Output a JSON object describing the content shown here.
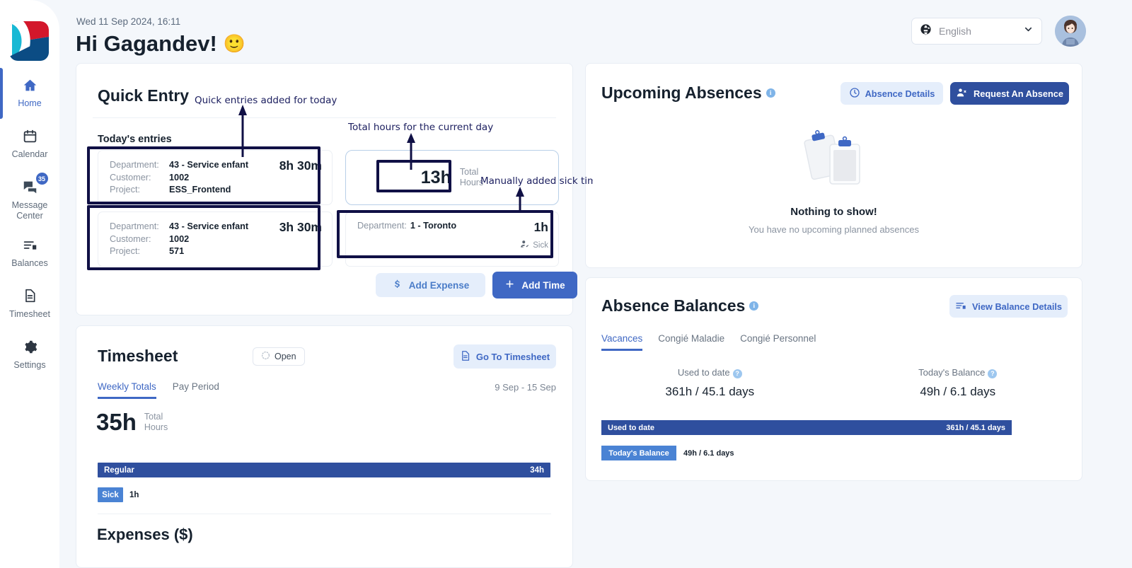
{
  "sidebar": {
    "logo_name": "company-logo",
    "items": [
      {
        "label": "Home",
        "icon": "home-icon",
        "active": true
      },
      {
        "label": "Calendar",
        "icon": "calendar-icon",
        "active": false
      },
      {
        "label": "Message\nCenter",
        "icon": "message-icon",
        "active": false,
        "badge": "35"
      },
      {
        "label": "Balances",
        "icon": "balances-icon",
        "active": false
      },
      {
        "label": "Timesheet",
        "icon": "document-icon",
        "active": false
      },
      {
        "label": "Settings",
        "icon": "gear-icon",
        "active": false
      }
    ]
  },
  "header": {
    "datetime": "Wed 11 Sep 2024, 16:11",
    "greeting": "Hi Gagandev!",
    "greeting_emoji": "🙂",
    "language": "English",
    "language_icon": "globe-icon",
    "chevron_icon": "chevron-down-icon",
    "avatar_alt": "user-avatar"
  },
  "quick_entry": {
    "title": "Quick Entry",
    "subtitle": "Today's entries",
    "entries": [
      {
        "department_label": "Department:",
        "department_value": "43 - Service enfant",
        "customer_label": "Customer:",
        "customer_value": "1002",
        "project_label": "Project:",
        "project_value": "ESS_Frontend",
        "hours": "8h 30m"
      },
      {
        "department_label": "Department:",
        "department_value": "43 - Service enfant",
        "customer_label": "Customer:",
        "customer_value": "1002",
        "project_label": "Project:",
        "project_value": "571",
        "hours": "3h 30m"
      }
    ],
    "total": {
      "value": "13h",
      "label_line1": "Total",
      "label_line2": "Hours"
    },
    "sick_entry": {
      "department_label": "Department:",
      "department_value": "1 - Toronto",
      "hours": "1h",
      "tag": "Sick",
      "tag_icon": "person-check-icon"
    },
    "add_expense_label": "Add Expense",
    "add_expense_icon": "dollar-icon",
    "add_time_label": "Add Time",
    "add_time_icon": "plus-icon"
  },
  "annotations": [
    {
      "text": "Quick entries added for today"
    },
    {
      "text": "Total hours for the current day"
    },
    {
      "text": "Manually added sick time"
    }
  ],
  "timesheet": {
    "title": "Timesheet",
    "status": "Open",
    "status_icon": "dotted-circle-icon",
    "goto_label": "Go To Timesheet",
    "goto_icon": "document-icon",
    "tabs": [
      {
        "label": "Weekly Totals",
        "active": true
      },
      {
        "label": "Pay Period",
        "active": false
      }
    ],
    "date_range": "9 Sep - 15 Sep",
    "total_value": "35h",
    "total_label_line1": "Total",
    "total_label_line2": "Hours",
    "bars": [
      {
        "label": "Regular",
        "value": "34h"
      },
      {
        "label": "Sick",
        "value": "1h"
      }
    ],
    "expenses_title": "Expenses ($)"
  },
  "upcoming_absences": {
    "title": "Upcoming Absences",
    "info_icon": "info-icon",
    "details_label": "Absence Details",
    "details_icon": "clock-icon",
    "request_label": "Request An Absence",
    "request_icon": "person-remove-icon",
    "empty_icon": "clipboards-icon",
    "empty_title": "Nothing to show!",
    "empty_text": "You have no upcoming planned absences"
  },
  "absence_balances": {
    "title": "Absence Balances",
    "info_icon": "info-icon",
    "view_details_label": "View Balance Details",
    "view_details_icon": "balances-icon",
    "tabs": [
      {
        "label": "Vacances",
        "active": true
      },
      {
        "label": "Congié Maladie",
        "active": false
      },
      {
        "label": "Congié Personnel",
        "active": false
      }
    ],
    "stats": [
      {
        "label": "Used to date",
        "value": "361h / 45.1 days",
        "help_icon": "question-icon"
      },
      {
        "label": "Today's Balance",
        "value": "49h / 6.1 days",
        "help_icon": "question-icon"
      }
    ],
    "bars": [
      {
        "label": "Used to date",
        "value": "361h / 45.1 days"
      },
      {
        "label": "Today's Balance",
        "value": "49h / 6.1 days"
      }
    ]
  },
  "colors": {
    "accent": "#3f68c4",
    "accent_dark": "#2f4f9e",
    "accent_light": "#4a83d4",
    "soft_bg": "#e5eefb",
    "page_bg": "#f4f7fb",
    "annotation": "#101045"
  }
}
